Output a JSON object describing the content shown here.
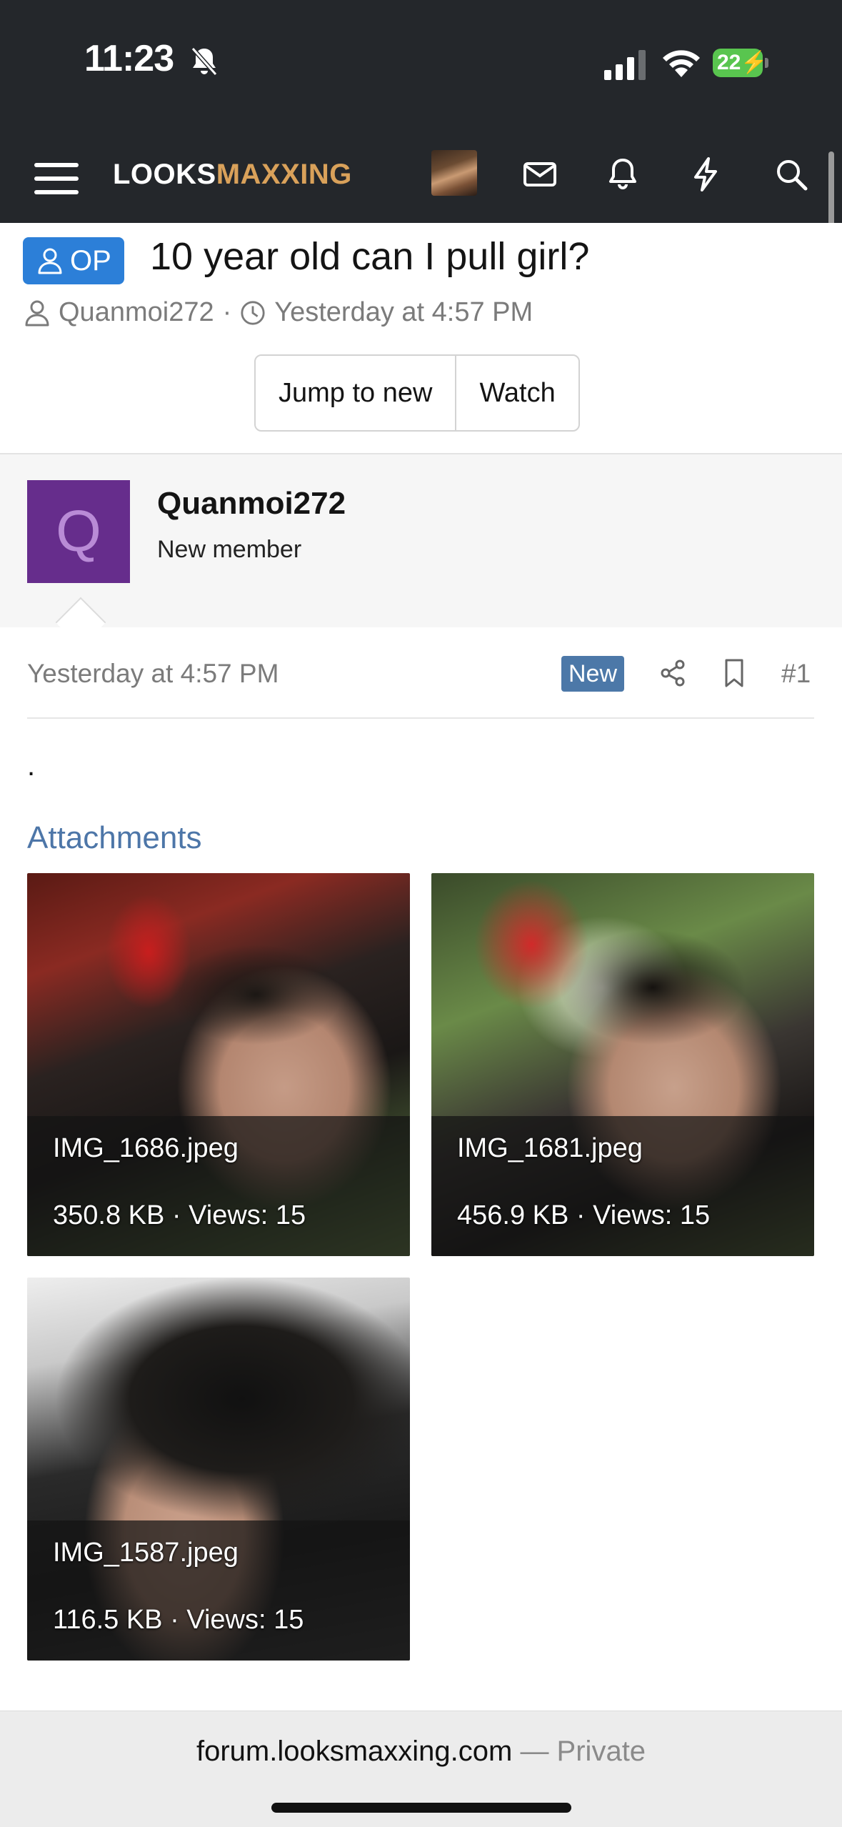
{
  "status_bar": {
    "time": "11:23",
    "battery": "22",
    "icons": [
      "bell-slash-icon",
      "cellular-signal-icon",
      "wifi-icon",
      "battery-charging-icon"
    ]
  },
  "nav": {
    "logo_part1": "LOOKS",
    "logo_part2": "MAXXING",
    "logo_color_primary": "#ffffff",
    "logo_color_accent": "#d9a15a",
    "icons": [
      "menu-icon",
      "avatar",
      "envelope-icon",
      "bell-icon",
      "lightning-icon",
      "search-icon"
    ]
  },
  "thread": {
    "op_label": "OP",
    "title": "10 year old can I pull girl?",
    "author": "Quanmoi272",
    "separator": "·",
    "date": "Yesterday at 4:57 PM",
    "buttons": {
      "jump": "Jump to new",
      "watch": "Watch"
    }
  },
  "user": {
    "avatar_letter": "Q",
    "avatar_color": "#662d8c",
    "name": "Quanmoi272",
    "title": "New member"
  },
  "post": {
    "date": "Yesterday at 4:57 PM",
    "new_badge": "New",
    "number": "#1",
    "body": ".",
    "attachments_title": "Attachments",
    "attachments": [
      {
        "filename": "IMG_1686.jpeg",
        "meta": "350.8 KB · Views: 15"
      },
      {
        "filename": "IMG_1681.jpeg",
        "meta": "456.9 KB · Views: 15"
      },
      {
        "filename": "IMG_1587.jpeg",
        "meta": "116.5 KB · Views: 15"
      }
    ]
  },
  "browser": {
    "domain": "forum.looksmaxxing.com",
    "private_label": " — Private"
  },
  "colors": {
    "header_bg": "#24272b",
    "op_badge": "#2c7fd8",
    "new_badge": "#4c78a8",
    "link": "#4d76a8"
  }
}
